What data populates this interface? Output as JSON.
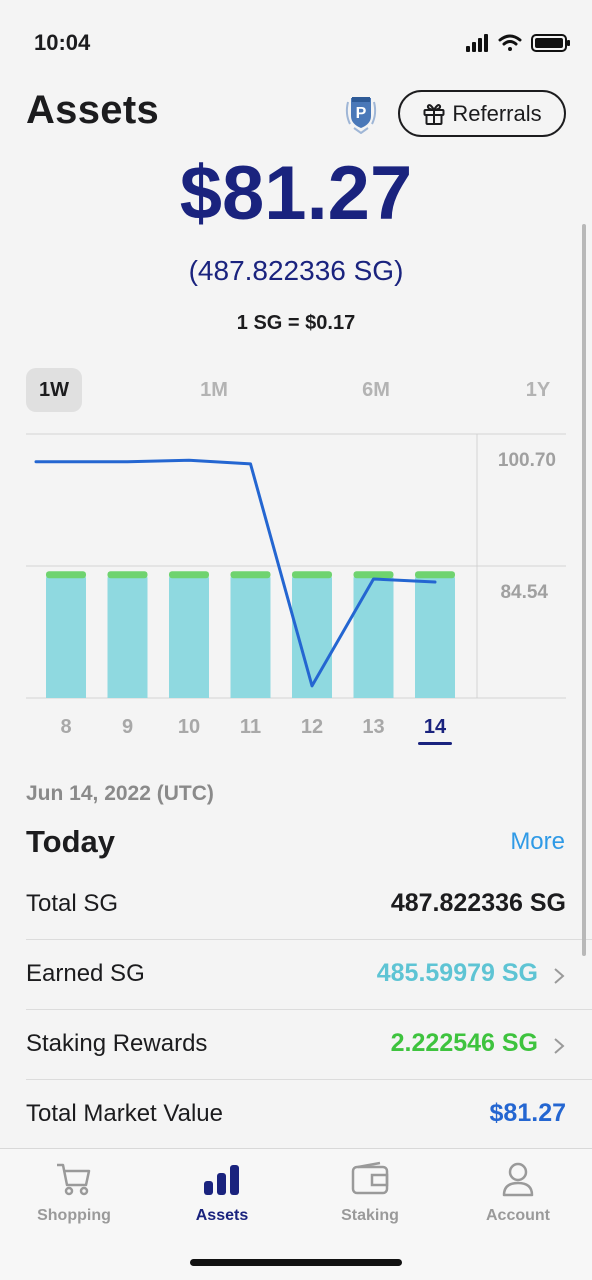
{
  "status": {
    "time": "10:04"
  },
  "header": {
    "title": "Assets",
    "referrals_label": "Referrals"
  },
  "balance": {
    "usd": "$81.27",
    "sg": "(487.822336 SG)",
    "rate": "1 SG = $0.17"
  },
  "ranges": [
    {
      "label": "1W",
      "active": true
    },
    {
      "label": "1M",
      "active": false
    },
    {
      "label": "6M",
      "active": false
    },
    {
      "label": "1Y",
      "active": false
    }
  ],
  "chart_data": {
    "type": "bar+line",
    "categories": [
      "8",
      "9",
      "10",
      "11",
      "12",
      "13",
      "14"
    ],
    "selected_category": "14",
    "line_series": {
      "values": [
        100.0,
        100.0,
        100.2,
        99.7,
        70.0,
        84.3,
        83.9
      ]
    },
    "bar_series": {
      "values": [
        84.54,
        84.54,
        84.54,
        84.54,
        84.54,
        84.54,
        84.54
      ]
    },
    "y_ticks": [
      "100.70",
      "84.54"
    ],
    "ylim": [
      68.38,
      103.7
    ],
    "colors": {
      "line": "#2466d1",
      "bar": "#8fd9e0",
      "bar_cap": "#6fd36f"
    }
  },
  "date_label": "Jun 14, 2022 (UTC)",
  "today": {
    "title": "Today",
    "more": "More",
    "rows": [
      {
        "label": "Total SG",
        "value": "487.822336 SG",
        "color": "#1c1c1e",
        "chevron": false
      },
      {
        "label": "Earned SG",
        "value": "485.59979 SG",
        "color": "#5ec4d4",
        "chevron": true
      },
      {
        "label": "Staking Rewards",
        "value": "2.222546 SG",
        "color": "#3ec33e",
        "chevron": true
      },
      {
        "label": "Total Market Value",
        "value": "$81.27",
        "color": "#2466d1",
        "chevron": false
      }
    ]
  },
  "tabs": [
    {
      "label": "Shopping",
      "icon": "cart-icon",
      "active": false
    },
    {
      "label": "Assets",
      "icon": "bar-chart-icon",
      "active": true
    },
    {
      "label": "Staking",
      "icon": "wallet-icon",
      "active": false
    },
    {
      "label": "Account",
      "icon": "person-icon",
      "active": false
    }
  ]
}
